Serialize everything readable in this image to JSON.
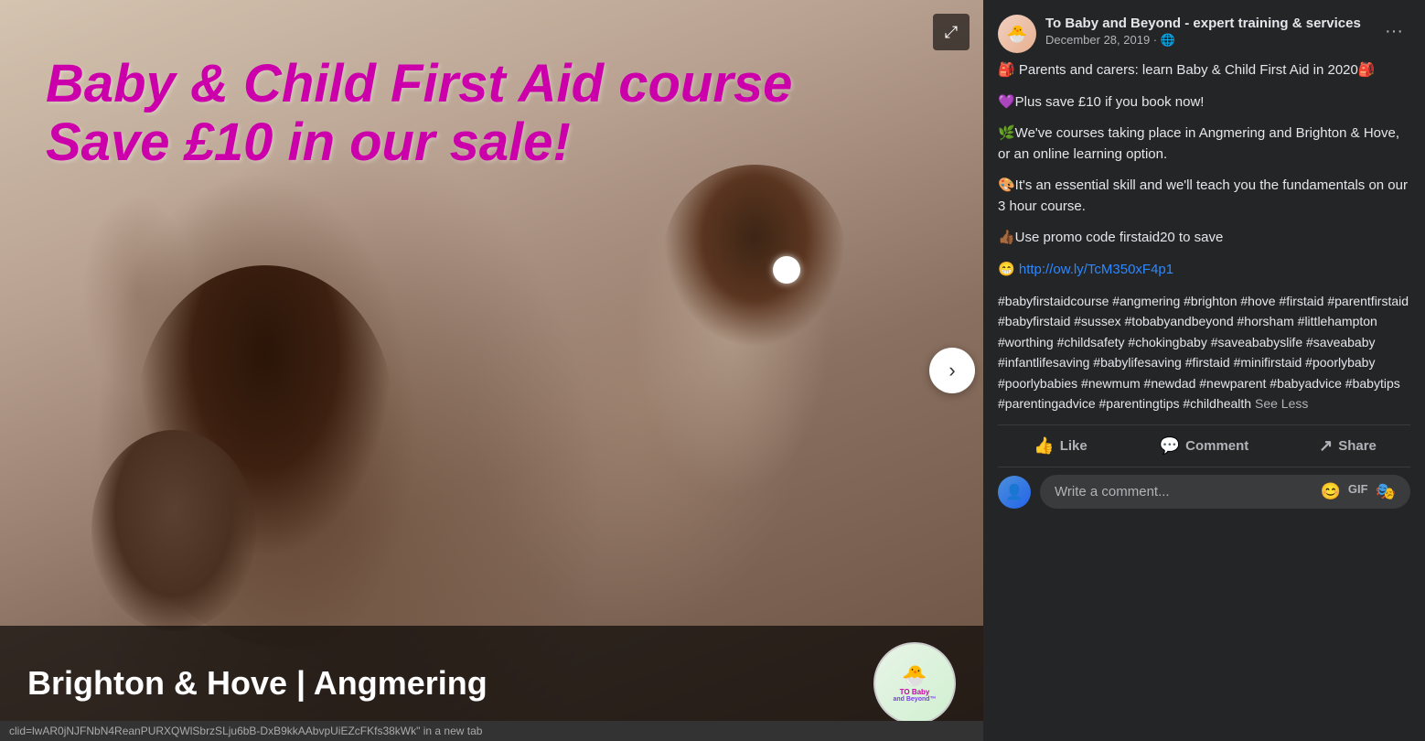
{
  "image": {
    "title_line1": "Baby & Child First Aid course",
    "title_line2": "Save £10 in our sale!",
    "location": "Brighton & Hove | Angmering",
    "logo_text_top": "TO Baby",
    "logo_text_bottom": "and Beyond™",
    "expand_icon": "⤢",
    "url_bar": "clid=lwAR0jNJFNbN4ReanPURXQWlSbrzSLju6bB-DxB9kkAAbvpUiEZcFKfs38kWk\" in a new tab"
  },
  "post": {
    "page_name": "To Baby and Beyond - expert training & services",
    "date": "December 28, 2019 · 🌐",
    "more_icon": "···",
    "paragraph1": "🎒 Parents and carers: learn Baby & Child First Aid in 2020🎒",
    "paragraph2": "💜Plus save £10 if you book now!",
    "paragraph3": "🌿We've courses taking place in Angmering and Brighton & Hove, or an online learning option.",
    "paragraph4": "🎨It's an essential skill and we'll teach you the fundamentals on our 3 hour course.",
    "paragraph5": "👍🏾Use promo code firstaid20 to save",
    "link_text": "http://ow.ly/TcM350xF4p1",
    "hashtags": "#babyfirstaidcourse #angmering #brighton #hove #firstaid #parentfirstaid #babyfirstaid #sussex #tobabyandbeyond #horsham #littlehampton #worthing #childsafety #chokingbaby #saveababyslife #saveababy #infantlifesaving #babylifesaving #firstaid #minifirstaid #poorlybaby #poorlybabies #newmum #newdad #newparent #babyadvice #babytips #parentingadvice #parentingtips #childhealth",
    "see_less": "See Less",
    "like_label": "Like",
    "comment_label": "Comment",
    "share_label": "Share",
    "comment_placeholder": "Write a comment...",
    "emoji_icon": "😊",
    "gif_label": "GIF",
    "sticker_icon": "🎭",
    "link_emoji": "😁"
  },
  "colors": {
    "title_color": "#cc00aa",
    "bg_dark": "#242526",
    "text_primary": "#e4e6eb",
    "text_secondary": "#b0b3b8",
    "link_color": "#2d88ff"
  }
}
